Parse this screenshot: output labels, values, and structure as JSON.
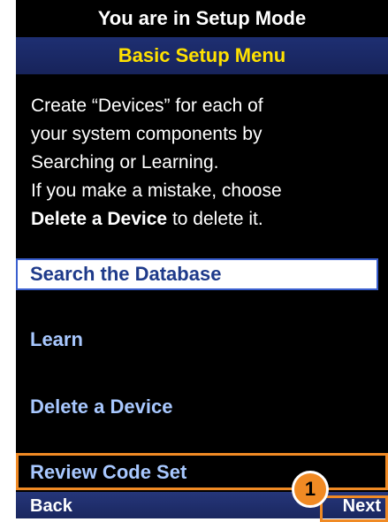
{
  "header": {
    "mode_text": "You are in Setup Mode",
    "menu_title": "Basic Setup Menu"
  },
  "instructions": {
    "line1": "Create “Devices” for each of",
    "line2": "your system components by",
    "line3": "Searching or Learning.",
    "line4": "If you make a mistake, choose",
    "line5_bold": "Delete a Device",
    "line5_rest": " to delete it."
  },
  "menu": {
    "items": [
      {
        "label": "Search the Database",
        "selected": true
      },
      {
        "label": "Learn",
        "selected": false
      },
      {
        "label": "Delete a Device",
        "selected": false
      },
      {
        "label": "Review Code Set",
        "selected": false
      }
    ]
  },
  "softkeys": {
    "back_label": "Back",
    "next_label": "Next"
  },
  "callout": {
    "number": "1",
    "color": "#f08a24"
  },
  "colors": {
    "menu_title_text": "#ffe100",
    "menu_item_text": "#a8c8ff",
    "selection_background": "#ffffff",
    "bar_background": "#1e2f72"
  }
}
